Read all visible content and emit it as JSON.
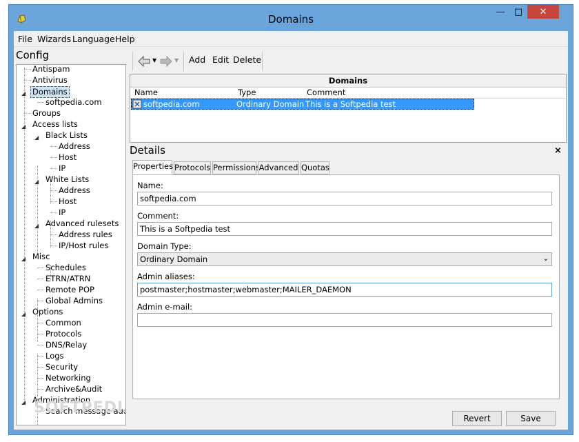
{
  "window": {
    "title": "Domains"
  },
  "menu": [
    "File",
    "Wizards",
    "Language",
    "Help"
  ],
  "config": {
    "title": "Config",
    "tree": [
      {
        "label": "Antispam"
      },
      {
        "label": "Antivirus"
      },
      {
        "label": "Domains",
        "selected": true
      },
      {
        "label": "softpedia.com"
      },
      {
        "label": "Groups"
      },
      {
        "label": "Access lists"
      },
      {
        "label": "Black Lists"
      },
      {
        "label": "Address"
      },
      {
        "label": "Host"
      },
      {
        "label": "IP"
      },
      {
        "label": "White Lists"
      },
      {
        "label": "Address"
      },
      {
        "label": "Host"
      },
      {
        "label": "IP"
      },
      {
        "label": "Advanced rulesets"
      },
      {
        "label": "Address rules"
      },
      {
        "label": "IP/Host rules"
      },
      {
        "label": "Misc"
      },
      {
        "label": "Schedules"
      },
      {
        "label": "ETRN/ATRN"
      },
      {
        "label": "Remote POP"
      },
      {
        "label": "Global Admins"
      },
      {
        "label": "Options"
      },
      {
        "label": "Common"
      },
      {
        "label": "Protocols"
      },
      {
        "label": "DNS/Relay"
      },
      {
        "label": "Logs"
      },
      {
        "label": "Security"
      },
      {
        "label": "Networking"
      },
      {
        "label": "Archive&Audit"
      },
      {
        "label": "Administration"
      },
      {
        "label": "Search message audit"
      }
    ],
    "watermark": "SOFTPEDIA"
  },
  "toolbar": {
    "add": "Add",
    "edit": "Edit",
    "delete": "Delete"
  },
  "domains": {
    "title": "Domains",
    "columns": [
      "Name",
      "Type",
      "Comment"
    ],
    "rows": [
      {
        "name": "softpedia.com",
        "type": "Ordinary Domain",
        "comment": "This is a Softpedia test"
      }
    ]
  },
  "details": {
    "title": "Details",
    "close": "×",
    "tabs": [
      "Properties",
      "Protocols",
      "Permissions",
      "Advanced",
      "Quotas"
    ],
    "active_tab": "Properties",
    "fields": {
      "name_label": "Name:",
      "name_value": "softpedia.com",
      "comment_label": "Comment:",
      "comment_value": "This is a Softpedia test",
      "type_label": "Domain Type:",
      "type_value": "Ordinary Domain",
      "aliases_label": "Admin aliases:",
      "aliases_value": "postmaster;hostmaster;webmaster;MAILER_DAEMON",
      "email_label": "Admin e-mail:",
      "email_value": ""
    }
  },
  "buttons": {
    "revert": "Revert",
    "save": "Save"
  }
}
